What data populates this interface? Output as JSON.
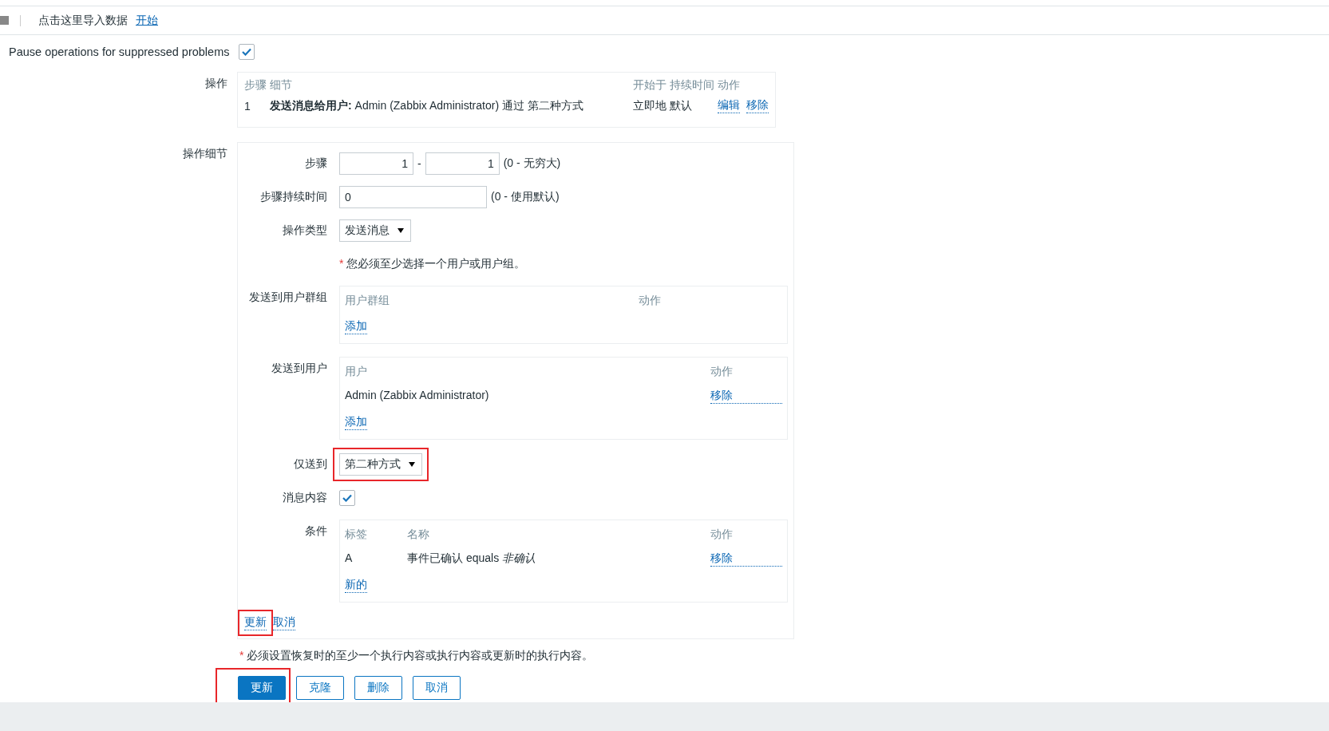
{
  "import_bar": {
    "text": "点击这里导入数据",
    "link": "开始"
  },
  "pause_suppressed": {
    "label": "Pause operations for suppressed problems",
    "checked": true
  },
  "operations": {
    "label": "操作",
    "columns": [
      "步骤",
      "细节",
      "开始于",
      "持续时间",
      "动作"
    ],
    "rows": [
      {
        "step": "1",
        "detail": "**发送消息给用户:** Admin (Zabbix Administrator) 通过 第二种方式",
        "start": "立即地",
        "duration": "默认",
        "actions": [
          "编辑",
          "移除"
        ]
      }
    ]
  },
  "details": {
    "label": "操作细节",
    "step": {
      "label": "步骤",
      "from": "1",
      "separator": "-",
      "to": "1",
      "hint": "(0 - 无穷大)"
    },
    "step_duration": {
      "label": "步骤持续时间",
      "value": "0",
      "hint": "(0 - 使用默认)"
    },
    "operation_type": {
      "label": "操作类型",
      "value": "发送消息"
    },
    "required_note": {
      "mark": "*",
      "text": "您必须至少选择一个用户或用户组。"
    },
    "user_groups": {
      "label": "发送到用户群组",
      "columns": [
        "用户群组",
        "动作"
      ],
      "add": "添加"
    },
    "users": {
      "label": "发送到用户",
      "columns": [
        "用户",
        "动作"
      ],
      "rows": [
        {
          "name": "Admin (Zabbix Administrator)",
          "action": "移除"
        }
      ],
      "add": "添加"
    },
    "send_only_to": {
      "label": "仅送到",
      "value": "第二种方式"
    },
    "default_message": {
      "label": "消息内容",
      "checked": true
    },
    "conditions": {
      "label": "条件",
      "columns": [
        "标签",
        "名称",
        "动作"
      ],
      "rows": [
        {
          "tag": "A",
          "name": "事件已确认 equals *非确认*",
          "action": "移除"
        }
      ],
      "add": "新的"
    },
    "links": [
      "更新",
      "取消"
    ]
  },
  "bottom_note": {
    "mark": "*",
    "text": "必须设置恢复时的至少一个执行内容或执行内容或更新时的执行内容。"
  },
  "buttons": [
    {
      "label": "更新",
      "kind": "primary"
    },
    {
      "label": "克隆",
      "kind": "secondary"
    },
    {
      "label": "删除",
      "kind": "secondary"
    },
    {
      "label": "取消",
      "kind": "secondary"
    }
  ],
  "annotations": [
    {
      "kind": "highlight-box"
    },
    {
      "kind": "highlight-box"
    },
    {
      "kind": "highlight-box"
    }
  ]
}
